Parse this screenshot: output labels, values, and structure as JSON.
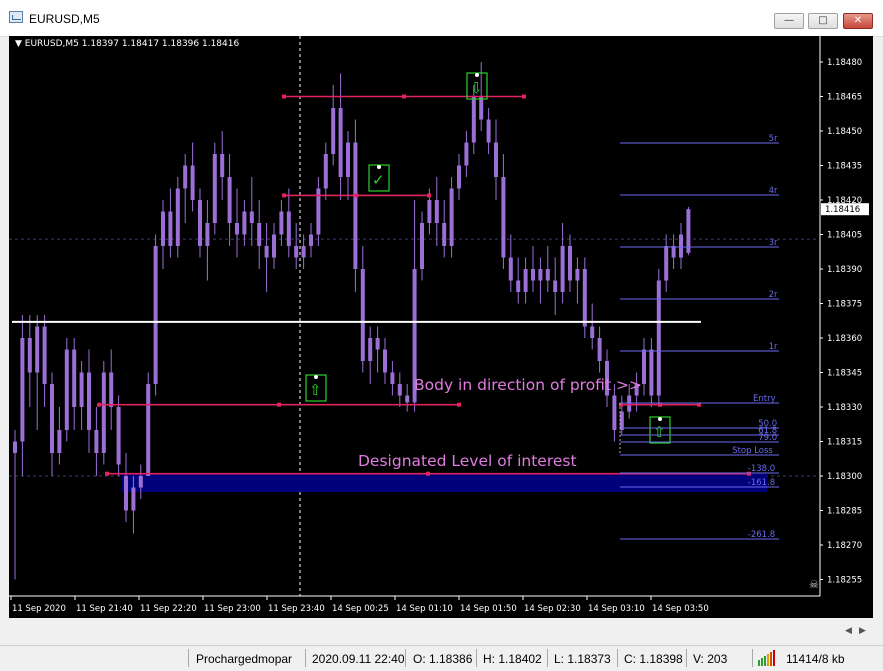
{
  "window": {
    "title": "EURUSD,M5",
    "minimize_glyph": "—",
    "maximize_glyph": "□",
    "close_glyph": "✕"
  },
  "chart": {
    "header": "▼ EURUSD,M5  1.18397 1.18417 1.18396 1.18416",
    "current_price": "1.18416",
    "price_labels": [
      "1.18480",
      "1.18465",
      "1.18450",
      "1.18435",
      "1.18420",
      "1.18405",
      "1.18390",
      "1.18375",
      "1.18360",
      "1.18345",
      "1.18330",
      "1.18315",
      "1.18300",
      "1.18285",
      "1.18270",
      "1.18255"
    ],
    "time_labels": [
      "11 Sep 2020",
      "11 Sep 21:40",
      "11 Sep 22:20",
      "11 Sep 23:00",
      "11 Sep 23:40",
      "14 Sep 00:25",
      "14 Sep 01:10",
      "14 Sep 01:50",
      "14 Sep 02:30",
      "14 Sep 03:10",
      "14 Sep 03:50"
    ],
    "annotation_profit": "Body in direction of profit >>",
    "annotation_level": "Designated Level of interest",
    "fib_labels": [
      "5r",
      "4r",
      "3r",
      "2r",
      "1r",
      "Entry",
      "50.0",
      "61.8",
      "79.0",
      "Stop Loss",
      "-138.0",
      "-161.8",
      "-261.8"
    ],
    "colors": {
      "bull": "#9b6fd6",
      "bear": "#9b6fd6",
      "red_line": "#e0245e",
      "fib": "#6a6af0",
      "zone": "#00007a",
      "annotation": "#e07be0",
      "white_line": "#ffffff"
    }
  },
  "statusbar": {
    "profile": "Prochargedmopar",
    "datetime": "2020.09.11 22:40",
    "open": "O: 1.18386",
    "high": "H: 1.18402",
    "low": "L: 1.18373",
    "close": "C: 1.18398",
    "volume": "V: 203",
    "traffic": "11414/8 kb"
  }
}
